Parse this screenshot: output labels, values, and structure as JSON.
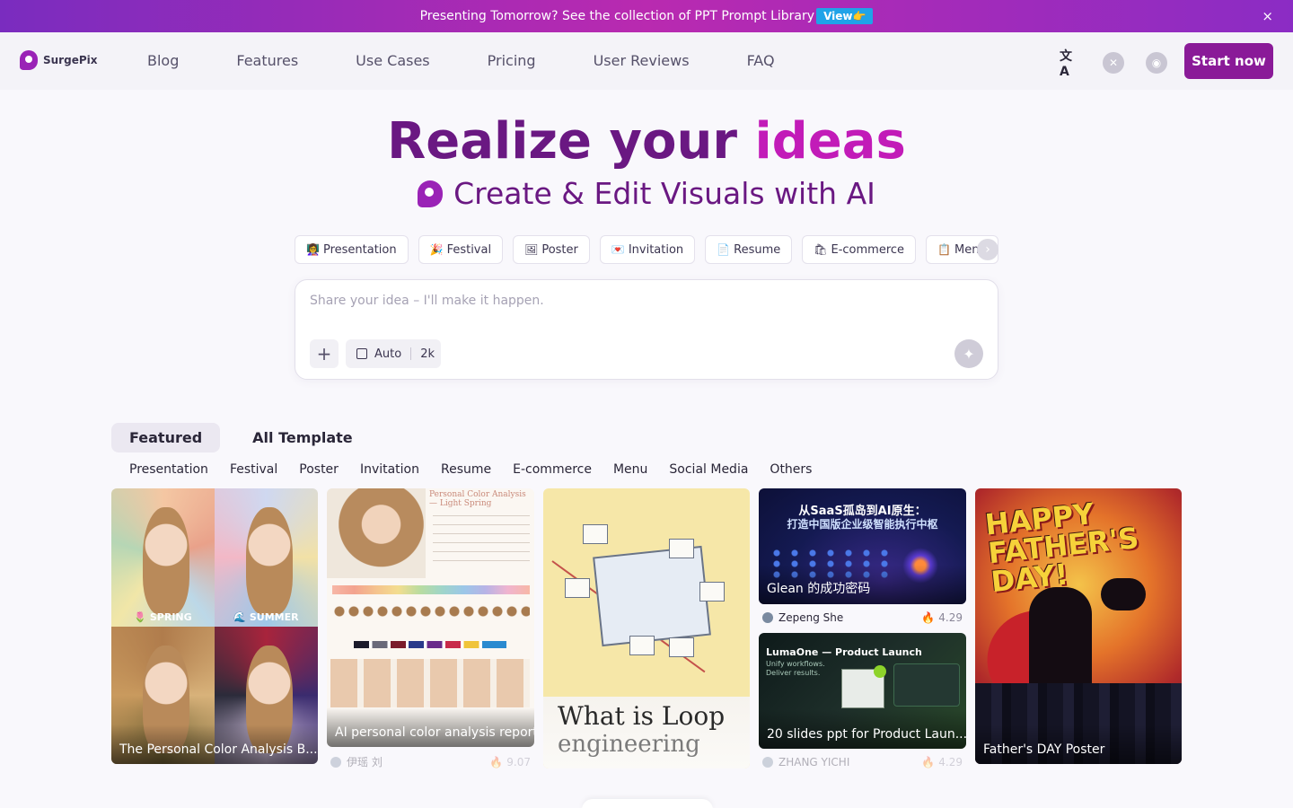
{
  "banner": {
    "text": "Presenting Tomorrow? See the collection of PPT Prompt Library",
    "view_label": "View👉",
    "close_icon": "×"
  },
  "brand": {
    "name": "SurgePix"
  },
  "nav": {
    "links": [
      "Blog",
      "Features",
      "Use Cases",
      "Pricing",
      "User Reviews",
      "FAQ"
    ],
    "translate_icon": "文A",
    "x_icon": "✕",
    "discord_icon": "◉",
    "start_label": "Start now"
  },
  "hero": {
    "title_part1": "Realize your",
    "title_part2": "ideas",
    "subtitle": "Create & Edit Visuals with AI"
  },
  "chips": [
    {
      "emoji": "👩‍🏫",
      "label": "Presentation"
    },
    {
      "emoji": "🎉",
      "label": "Festival"
    },
    {
      "emoji": "🖼",
      "label": "Poster"
    },
    {
      "emoji": "💌",
      "label": "Invitation"
    },
    {
      "emoji": "📄",
      "label": "Resume"
    },
    {
      "emoji": "🛍",
      "label": "E-commerce"
    },
    {
      "emoji": "📋",
      "label": "Menu"
    }
  ],
  "chip_next_icon": "›",
  "prompt": {
    "placeholder": "Share your idea – I'll make it happen.",
    "add_icon": "+",
    "ratio_label": "Auto",
    "resolution_label": "2k",
    "generate_icon": "✦"
  },
  "tabs": {
    "featured": "Featured",
    "all": "All Template"
  },
  "categories": [
    "Presentation",
    "Festival",
    "Poster",
    "Invitation",
    "Resume",
    "E-commerce",
    "Menu",
    "Social Media",
    "Others"
  ],
  "cards": {
    "c1": {
      "caption": "The Personal Color Analysis B...",
      "q1_label": "🌷 SPRING",
      "q2_label": "🌊 SUMMER"
    },
    "c2": {
      "caption": "AI personal color analysis report",
      "title": "Personal Color Analysis — Light Spring",
      "author": "伊瑶 刘",
      "count": "9.07"
    },
    "c3": {
      "line1": "What is Loop",
      "line2": "engineering"
    },
    "c4a": {
      "caption": "Glean 的成功密码",
      "zh1": "从SaaS孤岛到AI原生：",
      "zh2": "打造中国版企业级智能执行中枢",
      "author": "Zepeng She",
      "count": "4.29"
    },
    "c4b": {
      "caption": "20 slides ppt for Product Laun...",
      "t1": "LumaOne — Product Launch",
      "t2": "Unify workflows. Deliver results.",
      "author": "ZHANG YICHI",
      "count": "4.29"
    },
    "c5": {
      "caption": "Father's DAY Poster",
      "headline": "HAPPY FATHER'S DAY!"
    }
  }
}
